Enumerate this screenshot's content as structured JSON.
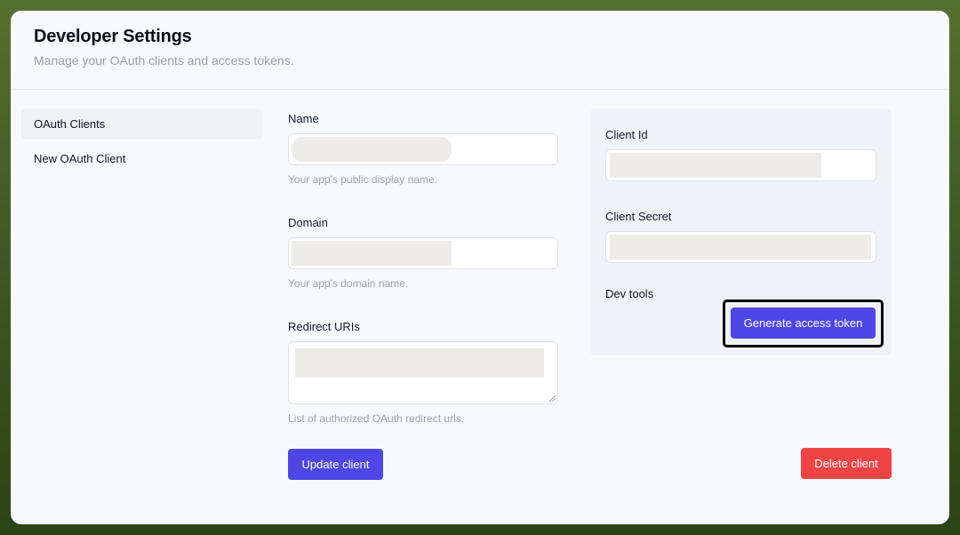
{
  "header": {
    "title": "Developer Settings",
    "subtitle": "Manage your OAuth clients and access tokens."
  },
  "sidebar": {
    "items": [
      {
        "label": "OAuth Clients",
        "active": true
      },
      {
        "label": "New OAuth Client",
        "active": false
      }
    ]
  },
  "form": {
    "name": {
      "label": "Name",
      "value": "",
      "help": "Your app's public display name."
    },
    "domain": {
      "label": "Domain",
      "value": "",
      "help": "Your app's domain name."
    },
    "redirect_uris": {
      "label": "Redirect URIs",
      "value": "",
      "help": "List of authorized OAuth redirect urls."
    },
    "update_label": "Update client",
    "delete_label": "Delete client"
  },
  "panel": {
    "client_id_label": "Client Id",
    "client_id_value": "",
    "client_secret_label": "Client Secret",
    "client_secret_value": "",
    "dev_tools_label": "Dev tools",
    "generate_label": "Generate access token"
  },
  "colors": {
    "accent": "#4f46e5",
    "danger": "#ef4444",
    "background": "#f8f9fb",
    "panel": "#eff2f7",
    "outer_frame": "#4a6428"
  }
}
